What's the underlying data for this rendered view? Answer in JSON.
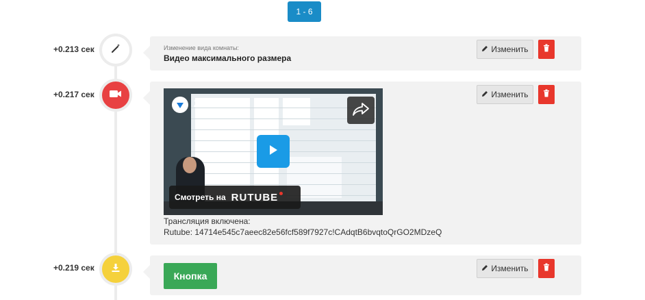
{
  "pagination": {
    "label": "1 - 6"
  },
  "edit_label": "Изменить",
  "events": [
    {
      "time": "+0.213 сек",
      "icon": "magic-wand-icon",
      "label": "Изменение вида комнаты:",
      "title": "Видео максимального размера"
    },
    {
      "time": "+0.217 сек",
      "icon": "video-camera-icon",
      "video": {
        "number": "2-1",
        "watch_label": "Смотреть на",
        "brand": "RUTUBE"
      },
      "status": "Трансляция включена:",
      "stream_id": "Rutube: 14714e545c7aeec82e56fcf589f7927c!CAdqtB6bvqtoQrGO2MDzeQ"
    },
    {
      "time": "+0.219 сек",
      "icon": "download-icon",
      "button_label": "Кнопка"
    }
  ],
  "colors": {
    "accent": "#1a8cc7",
    "video_event": "#e84142",
    "download_event": "#f5d13c",
    "button": "#3aa857",
    "delete": "#e8372c"
  }
}
